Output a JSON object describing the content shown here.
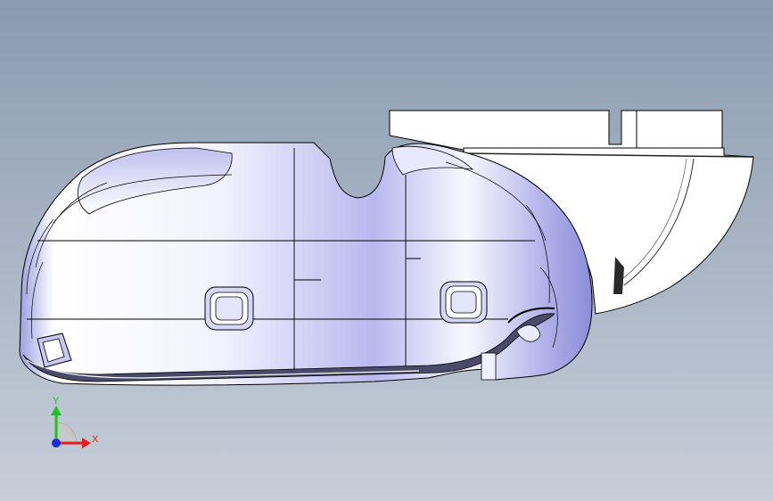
{
  "viewport": {
    "background_top": "#8a9bb0",
    "background_bottom": "#c7ced9",
    "part_shade_color": "#aaaaf0"
  },
  "triad": {
    "x_label": "X",
    "y_label": "Y",
    "x_color": "#e02020",
    "y_color": "#20c020",
    "z_color": "#1a2ed8"
  }
}
